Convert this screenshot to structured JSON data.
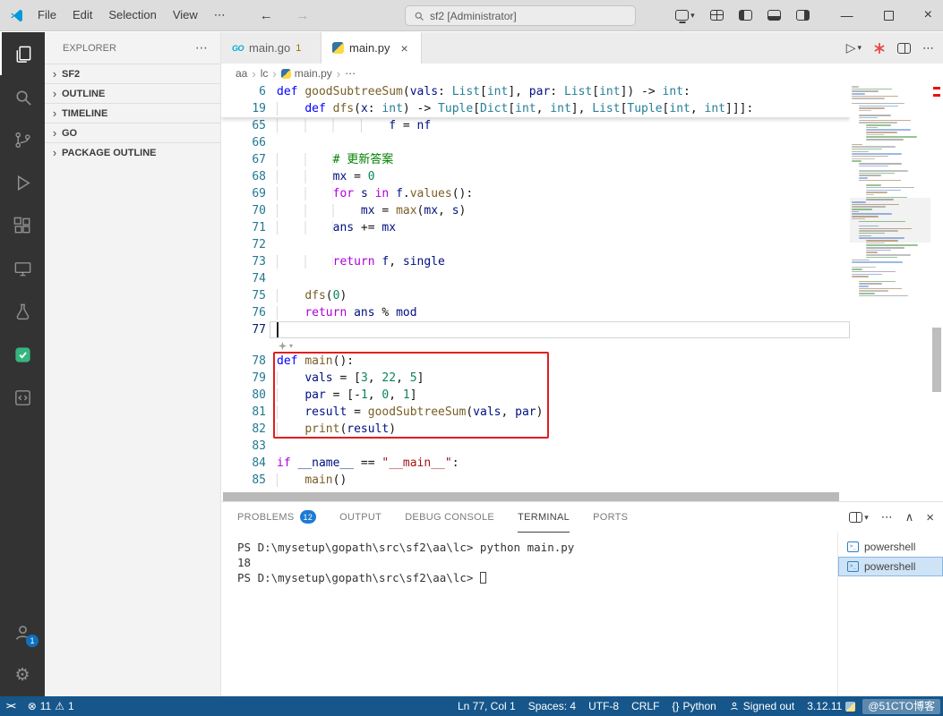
{
  "window": {
    "menus": [
      "File",
      "Edit",
      "Selection",
      "View"
    ],
    "menu_overflow": "⋯",
    "search_text": "sf2 [Administrator]"
  },
  "glyphs": {
    "back": "←",
    "forward": "→",
    "chevron_down": "▾",
    "chevron_right": "›",
    "more": "⋯",
    "run": "▷",
    "minimize": "—",
    "close": "×",
    "maximize_panel": "∧",
    "error": "⊗",
    "warning": "⚠",
    "braces": "{}",
    "remote": "><",
    "prompt": ">_"
  },
  "activity_bar": {
    "items": [
      "explorer",
      "search",
      "source-control",
      "run-and-debug",
      "extensions",
      "remote-explorer",
      "testing",
      "extension-custom",
      "extension-docs"
    ],
    "account_badge": "1"
  },
  "sidebar": {
    "title": "EXPLORER",
    "sections": [
      "SF2",
      "OUTLINE",
      "TIMELINE",
      "GO",
      "PACKAGE OUTLINE"
    ]
  },
  "editor_tabs": {
    "items": [
      {
        "label": "main.go",
        "icon": "go",
        "badge": "1"
      },
      {
        "label": "main.py",
        "icon": "python",
        "active": true,
        "close": "×"
      }
    ]
  },
  "breadcrumb": {
    "items": [
      "aa",
      "lc",
      "main.py",
      "⋯"
    ]
  },
  "editor": {
    "cursor_line": 77,
    "widget_before_line": 78,
    "annotation": {
      "from_line": 78,
      "to_line": 82
    },
    "sticky": [
      {
        "num": 6,
        "tokens": [
          [
            "kw",
            "def"
          ],
          [
            "df",
            " "
          ],
          [
            "fn",
            "goodSubtreeSum"
          ],
          [
            "df",
            "("
          ],
          [
            "va",
            "vals"
          ],
          [
            "df",
            ": "
          ],
          [
            "ty",
            "List"
          ],
          [
            "df",
            "["
          ],
          [
            "ty",
            "int"
          ],
          [
            "df",
            "], "
          ],
          [
            "va",
            "par"
          ],
          [
            "df",
            ": "
          ],
          [
            "ty",
            "List"
          ],
          [
            "df",
            "["
          ],
          [
            "ty",
            "int"
          ],
          [
            "df",
            "]) -> "
          ],
          [
            "ty",
            "int"
          ],
          [
            "df",
            ":"
          ]
        ]
      },
      {
        "num": 19,
        "tokens": [
          [
            "df",
            "    "
          ],
          [
            "kw",
            "def"
          ],
          [
            "df",
            " "
          ],
          [
            "fn",
            "dfs"
          ],
          [
            "df",
            "("
          ],
          [
            "va",
            "x"
          ],
          [
            "df",
            ": "
          ],
          [
            "ty",
            "int"
          ],
          [
            "df",
            ") -> "
          ],
          [
            "ty",
            "Tuple"
          ],
          [
            "df",
            "["
          ],
          [
            "ty",
            "Dict"
          ],
          [
            "df",
            "["
          ],
          [
            "ty",
            "int"
          ],
          [
            "df",
            ", "
          ],
          [
            "ty",
            "int"
          ],
          [
            "df",
            "], "
          ],
          [
            "ty",
            "List"
          ],
          [
            "df",
            "["
          ],
          [
            "ty",
            "Tuple"
          ],
          [
            "df",
            "["
          ],
          [
            "ty",
            "int"
          ],
          [
            "df",
            ", "
          ],
          [
            "ty",
            "int"
          ],
          [
            "df",
            "]]]:"
          ]
        ]
      }
    ],
    "lines": [
      {
        "num": 65,
        "tokens": [
          [
            "df",
            "                "
          ],
          [
            "va",
            "f"
          ],
          [
            "df",
            " = "
          ],
          [
            "va",
            "nf"
          ]
        ]
      },
      {
        "num": 66,
        "tokens": []
      },
      {
        "num": 67,
        "tokens": [
          [
            "df",
            "        "
          ],
          [
            "co",
            "# 更新答案"
          ]
        ]
      },
      {
        "num": 68,
        "tokens": [
          [
            "df",
            "        "
          ],
          [
            "va",
            "mx"
          ],
          [
            "df",
            " = "
          ],
          [
            "nu",
            "0"
          ]
        ]
      },
      {
        "num": 69,
        "tokens": [
          [
            "df",
            "        "
          ],
          [
            "cf",
            "for"
          ],
          [
            "df",
            " "
          ],
          [
            "va",
            "s"
          ],
          [
            "df",
            " "
          ],
          [
            "cf",
            "in"
          ],
          [
            "df",
            " "
          ],
          [
            "va",
            "f"
          ],
          [
            "df",
            "."
          ],
          [
            "fn",
            "values"
          ],
          [
            "df",
            "():"
          ]
        ]
      },
      {
        "num": 70,
        "tokens": [
          [
            "df",
            "            "
          ],
          [
            "va",
            "mx"
          ],
          [
            "df",
            " = "
          ],
          [
            "fn",
            "max"
          ],
          [
            "df",
            "("
          ],
          [
            "va",
            "mx"
          ],
          [
            "df",
            ", "
          ],
          [
            "va",
            "s"
          ],
          [
            "df",
            ")"
          ]
        ]
      },
      {
        "num": 71,
        "tokens": [
          [
            "df",
            "        "
          ],
          [
            "va",
            "ans"
          ],
          [
            "df",
            " += "
          ],
          [
            "va",
            "mx"
          ]
        ]
      },
      {
        "num": 72,
        "tokens": []
      },
      {
        "num": 73,
        "tokens": [
          [
            "df",
            "        "
          ],
          [
            "cf",
            "return"
          ],
          [
            "df",
            " "
          ],
          [
            "va",
            "f"
          ],
          [
            "df",
            ", "
          ],
          [
            "va",
            "single"
          ]
        ]
      },
      {
        "num": 74,
        "tokens": []
      },
      {
        "num": 75,
        "tokens": [
          [
            "df",
            "    "
          ],
          [
            "fn",
            "dfs"
          ],
          [
            "df",
            "("
          ],
          [
            "nu",
            "0"
          ],
          [
            "df",
            ")"
          ]
        ]
      },
      {
        "num": 76,
        "tokens": [
          [
            "df",
            "    "
          ],
          [
            "cf",
            "return"
          ],
          [
            "df",
            " "
          ],
          [
            "va",
            "ans"
          ],
          [
            "df",
            " % "
          ],
          [
            "va",
            "mod"
          ]
        ]
      },
      {
        "num": 77,
        "tokens": []
      },
      {
        "num": 78,
        "tokens": [
          [
            "kw",
            "def"
          ],
          [
            "df",
            " "
          ],
          [
            "fn",
            "main"
          ],
          [
            "df",
            "():"
          ]
        ]
      },
      {
        "num": 79,
        "tokens": [
          [
            "df",
            "    "
          ],
          [
            "va",
            "vals"
          ],
          [
            "df",
            " = ["
          ],
          [
            "nu",
            "3"
          ],
          [
            "df",
            ", "
          ],
          [
            "nu",
            "22"
          ],
          [
            "df",
            ", "
          ],
          [
            "nu",
            "5"
          ],
          [
            "df",
            "]"
          ]
        ]
      },
      {
        "num": 80,
        "tokens": [
          [
            "df",
            "    "
          ],
          [
            "va",
            "par"
          ],
          [
            "df",
            " = [-"
          ],
          [
            "nu",
            "1"
          ],
          [
            "df",
            ", "
          ],
          [
            "nu",
            "0"
          ],
          [
            "df",
            ", "
          ],
          [
            "nu",
            "1"
          ],
          [
            "df",
            "]"
          ]
        ]
      },
      {
        "num": 81,
        "tokens": [
          [
            "df",
            "    "
          ],
          [
            "va",
            "result"
          ],
          [
            "df",
            " = "
          ],
          [
            "fn",
            "goodSubtreeSum"
          ],
          [
            "df",
            "("
          ],
          [
            "va",
            "vals"
          ],
          [
            "df",
            ", "
          ],
          [
            "va",
            "par"
          ],
          [
            "df",
            ")"
          ]
        ]
      },
      {
        "num": 82,
        "tokens": [
          [
            "df",
            "    "
          ],
          [
            "fn",
            "print"
          ],
          [
            "df",
            "("
          ],
          [
            "va",
            "result"
          ],
          [
            "df",
            ")"
          ]
        ]
      },
      {
        "num": 83,
        "tokens": []
      },
      {
        "num": 84,
        "tokens": [
          [
            "cf",
            "if"
          ],
          [
            "df",
            " "
          ],
          [
            "va",
            "__name__"
          ],
          [
            "df",
            " == "
          ],
          [
            "st",
            "\"__main__\""
          ],
          [
            "df",
            ":"
          ]
        ]
      },
      {
        "num": 85,
        "tokens": [
          [
            "df",
            "    "
          ],
          [
            "fn",
            "main"
          ],
          [
            "df",
            "()"
          ]
        ]
      }
    ]
  },
  "panel": {
    "tabs": [
      {
        "label": "PROBLEMS",
        "badge": "12"
      },
      {
        "label": "OUTPUT"
      },
      {
        "label": "DEBUG CONSOLE"
      },
      {
        "label": "TERMINAL",
        "active": true
      },
      {
        "label": "PORTS"
      }
    ],
    "terminal": {
      "lines": [
        {
          "tokens": [
            [
              "pr",
              "PS D:\\mysetup\\gopath\\src\\sf2\\aa\\lc>"
            ],
            [
              "cm",
              " python main.py"
            ]
          ]
        },
        {
          "tokens": [
            [
              "rb",
              "18"
            ]
          ]
        },
        {
          "tokens": [
            [
              "pr",
              "PS D:\\mysetup\\gopath\\src\\sf2\\aa\\lc> "
            ]
          ],
          "cursor": true
        }
      ]
    },
    "terminal_list": [
      {
        "label": "powershell"
      },
      {
        "label": "powershell",
        "selected": true
      }
    ]
  },
  "status_bar": {
    "errors": "11",
    "warnings": "1",
    "line_col": "Ln 77, Col 1",
    "indent": "Spaces: 4",
    "encoding": "UTF-8",
    "eol": "CRLF",
    "language": "Python",
    "copilot": "Signed out",
    "python_version": "3.12.11",
    "watermark": "@51CTO博客"
  },
  "colors": {
    "statusbar": "#16568a",
    "annotation": "#e01e1e",
    "badge": "#1e7ad4",
    "keyword": "#0000ff",
    "control": "#af00db",
    "string": "#a31515",
    "number": "#098658",
    "comment": "#008000"
  }
}
